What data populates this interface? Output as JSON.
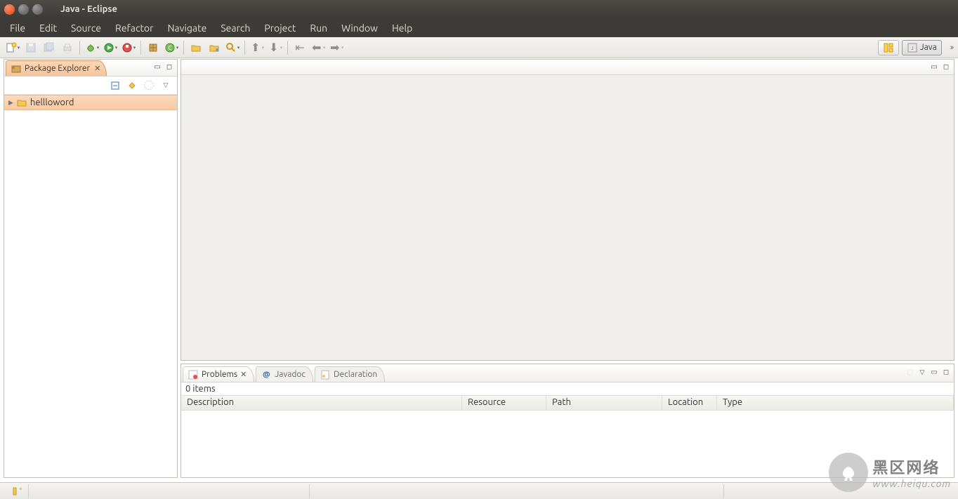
{
  "window": {
    "title": "Java - Eclipse"
  },
  "menu": {
    "items": [
      "File",
      "Edit",
      "Source",
      "Refactor",
      "Navigate",
      "Search",
      "Project",
      "Run",
      "Window",
      "Help"
    ]
  },
  "perspective": {
    "active": "Java"
  },
  "package_explorer": {
    "title": "Package Explorer",
    "projects": [
      {
        "name": "hellloword"
      }
    ]
  },
  "problems_view": {
    "tabs": [
      {
        "label": "Problems",
        "active": true
      },
      {
        "label": "Javadoc",
        "active": false
      },
      {
        "label": "Declaration",
        "active": false
      }
    ],
    "count_text": "0 items",
    "columns": [
      "Description",
      "Resource",
      "Path",
      "Location",
      "Type"
    ]
  },
  "watermark": {
    "line1": "黑区网络",
    "line2": "www.heiqu.com"
  }
}
